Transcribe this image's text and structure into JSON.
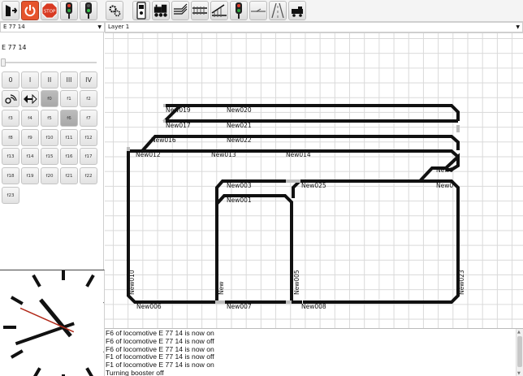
{
  "toolbar": {
    "buttons": [
      {
        "name": "layout-editor-button",
        "icon": "exit-door-icon"
      },
      {
        "name": "power-button",
        "icon": "power-icon"
      },
      {
        "name": "stop-button",
        "icon": "stop-icon",
        "label": "STOP"
      },
      {
        "name": "signal-button",
        "icon": "signal-icon"
      },
      {
        "name": "signal-green-button",
        "icon": "signal-green-icon"
      },
      {
        "name": "settings-button",
        "icon": "gears-icon"
      },
      {
        "name": "controller-button",
        "icon": "controller-icon"
      },
      {
        "name": "locomotive-button",
        "icon": "locomotive-icon"
      },
      {
        "name": "layers-button",
        "icon": "layers-icon"
      },
      {
        "name": "track-button",
        "icon": "track-icon"
      },
      {
        "name": "turnout-button",
        "icon": "turnout-icon"
      },
      {
        "name": "signal-edit-button",
        "icon": "signal-icon"
      },
      {
        "name": "feedback-button",
        "icon": "feedback-icon"
      },
      {
        "name": "route-button",
        "icon": "route-icon"
      },
      {
        "name": "loco-edit-button",
        "icon": "loco-edit-icon"
      }
    ]
  },
  "selectors": {
    "locomotive": "E 77 14",
    "layer": "Layer 1"
  },
  "loco_control": {
    "name": "E 77 14",
    "speed_fraction": 0,
    "direction_buttons": [
      "0",
      "I",
      "II",
      "III",
      "IV"
    ],
    "functions": [
      "f0",
      "f1",
      "f2",
      "f3",
      "f4",
      "f5",
      "f6",
      "f7",
      "f8",
      "f9",
      "f10",
      "f11",
      "f12",
      "f13",
      "f14",
      "f15",
      "f16",
      "f17",
      "f18",
      "f19",
      "f20",
      "f21",
      "f22",
      "f23"
    ],
    "active_functions": [
      "f0",
      "f6"
    ]
  },
  "clock": {
    "hour": 10,
    "minute": 41,
    "second": 49,
    "second_hand_color": "#b22a1a"
  },
  "layout": {
    "track_color": "#111111",
    "labels": {
      "new019": "New019",
      "new020": "New020",
      "new017": "New017",
      "new021": "New021",
      "new016": "New016",
      "new022": "New022",
      "new012": "New012",
      "new013": "New013",
      "new014": "New014",
      "new_tr1": "New0",
      "new_tr2": "New0",
      "new003": "New003",
      "new025": "New025",
      "new001": "New001",
      "new010": "New010",
      "new": "New",
      "new005": "New005",
      "new023": "New023",
      "new006": "New006",
      "new007": "New007",
      "new008": "New008"
    }
  },
  "log": {
    "lines": [
      "F6 of locomotive E 77 14 is now on",
      "F6 of locomotive E 77 14 is now off",
      "F6 of locomotive E 77 14 is now on",
      "F1 of locomotive E 77 14 is now off",
      "F1 of locomotive E 77 14 is now on",
      "Turning booster off"
    ]
  }
}
